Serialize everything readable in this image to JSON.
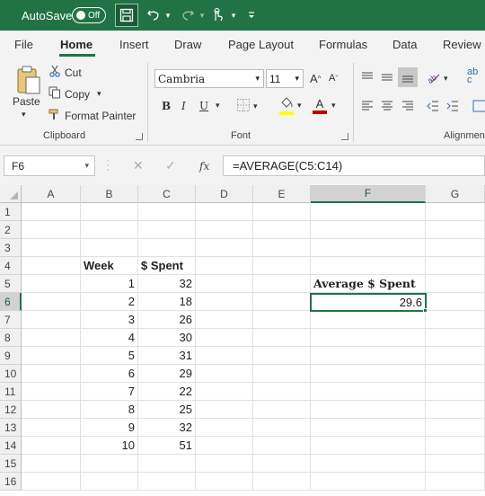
{
  "titlebar": {
    "autosave_label": "AutoSave",
    "toggle_state": "Off"
  },
  "tabs": [
    "File",
    "Home",
    "Insert",
    "Draw",
    "Page Layout",
    "Formulas",
    "Data",
    "Review"
  ],
  "clipboard": {
    "paste": "Paste",
    "cut": "Cut",
    "copy": "Copy",
    "format_painter": "Format Painter",
    "group_label": "Clipboard"
  },
  "font": {
    "family": "Cambria",
    "size": "11",
    "group_label": "Font",
    "bold": "B",
    "italic": "I",
    "underline": "U",
    "font_color_letter": "A",
    "grow": "A",
    "shrink": "A"
  },
  "alignment": {
    "group_label": "Alignmen"
  },
  "formula_bar": {
    "name_box": "F6",
    "fx": "fx",
    "formula": "=AVERAGE(C5:C14)"
  },
  "columns": [
    "A",
    "B",
    "C",
    "D",
    "E",
    "F",
    "G"
  ],
  "rows": [
    "1",
    "2",
    "3",
    "4",
    "5",
    "6",
    "7",
    "8",
    "9",
    "10",
    "11",
    "12",
    "13",
    "14",
    "15",
    "16"
  ],
  "table": {
    "week_header": "Week",
    "spent_header": "$ Spent",
    "weeks": [
      "1",
      "2",
      "3",
      "4",
      "5",
      "6",
      "7",
      "8",
      "9",
      "10"
    ],
    "spent": [
      "32",
      "18",
      "26",
      "30",
      "31",
      "29",
      "22",
      "25",
      "32",
      "51"
    ]
  },
  "summary": {
    "label": "Average $ Spent",
    "value": "29.6"
  },
  "colors": {
    "accent": "#217346",
    "font_color_bar": "#c00000",
    "highlight_bar": "#ffff00"
  }
}
